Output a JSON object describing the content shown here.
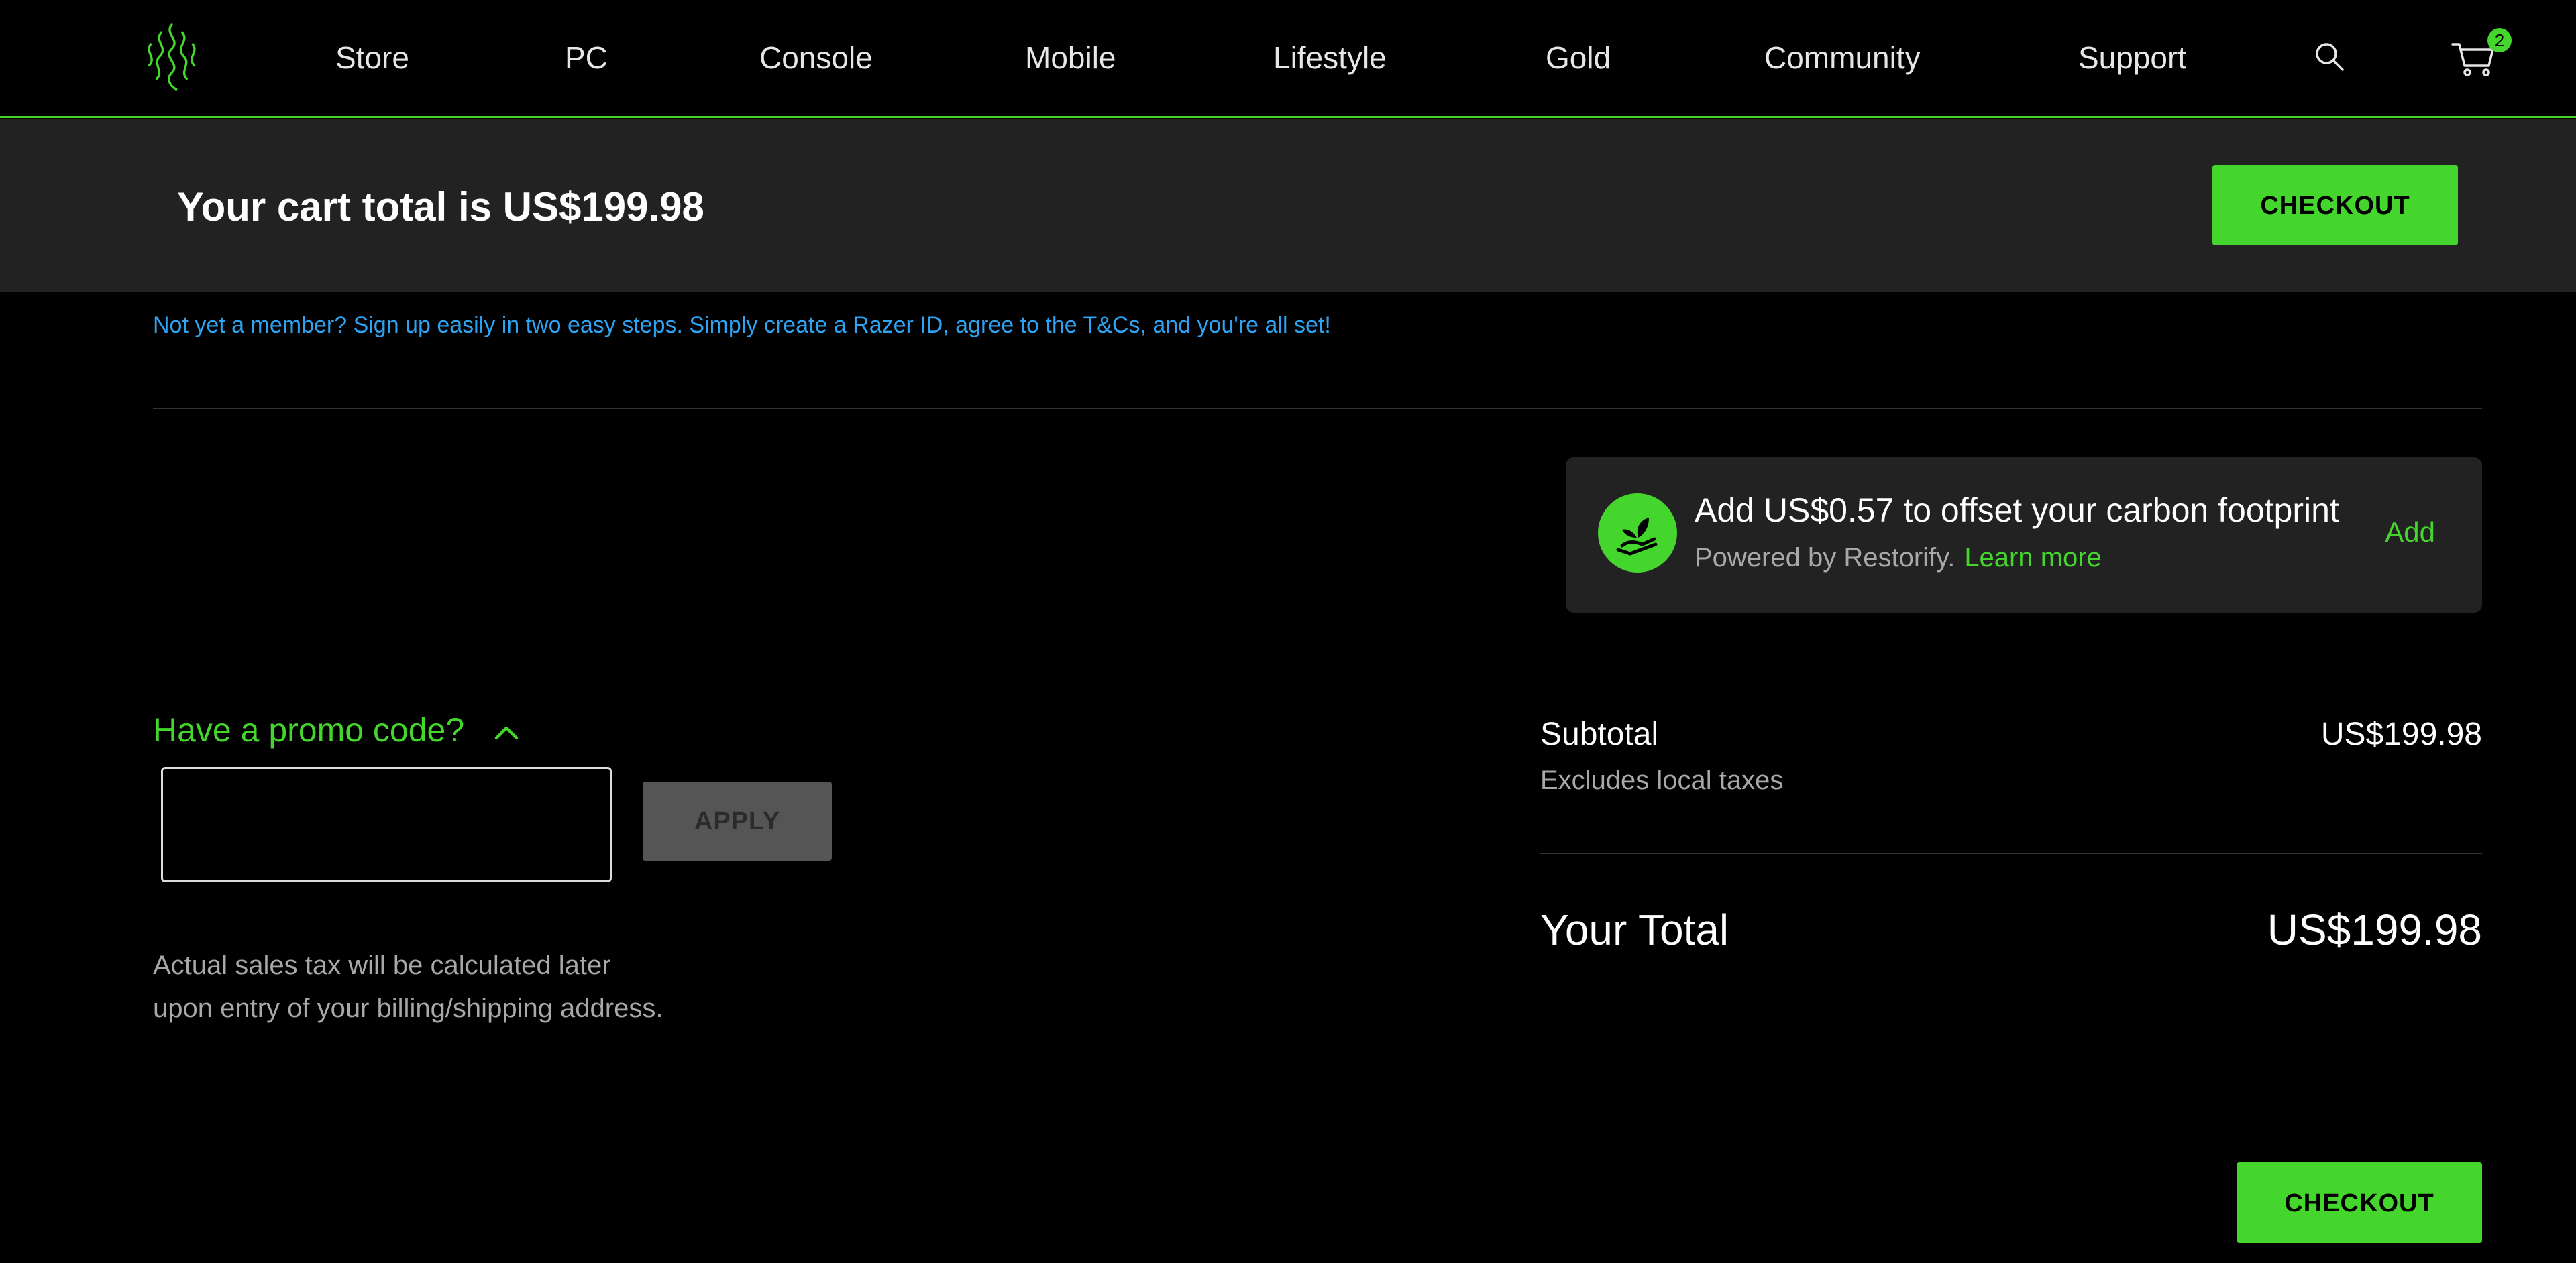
{
  "nav": {
    "items": [
      "Store",
      "PC",
      "Console",
      "Mobile",
      "Lifestyle",
      "Gold",
      "Community",
      "Support"
    ],
    "cart_count": "2"
  },
  "cart_bar": {
    "total_text": "Your cart total is US$199.98",
    "checkout_label": "CHECKOUT"
  },
  "member_note": "Not yet a member? Sign up easily in two easy steps. Simply create a Razer ID, agree to the T&Cs, and you're all set!",
  "carbon": {
    "title": "Add US$0.57 to offset your carbon footprint",
    "powered_by": "Powered by Restorify.",
    "learn_more": "Learn more",
    "add_label": "Add"
  },
  "promo": {
    "toggle_label": "Have a promo code?",
    "input_value": "",
    "apply_label": "APPLY"
  },
  "tax_note": {
    "line1": "Actual sales tax will be calculated later",
    "line2": "upon entry of your billing/shipping address."
  },
  "summary": {
    "subtotal_label": "Subtotal",
    "subtotal_value": "US$199.98",
    "subtotal_note": "Excludes local taxes",
    "total_label": "Your Total",
    "total_value": "US$199.98"
  },
  "checkout_bottom_label": "CHECKOUT",
  "colors": {
    "accent": "#44d62c",
    "link_blue": "#2ea3f2",
    "panel": "#222222"
  }
}
